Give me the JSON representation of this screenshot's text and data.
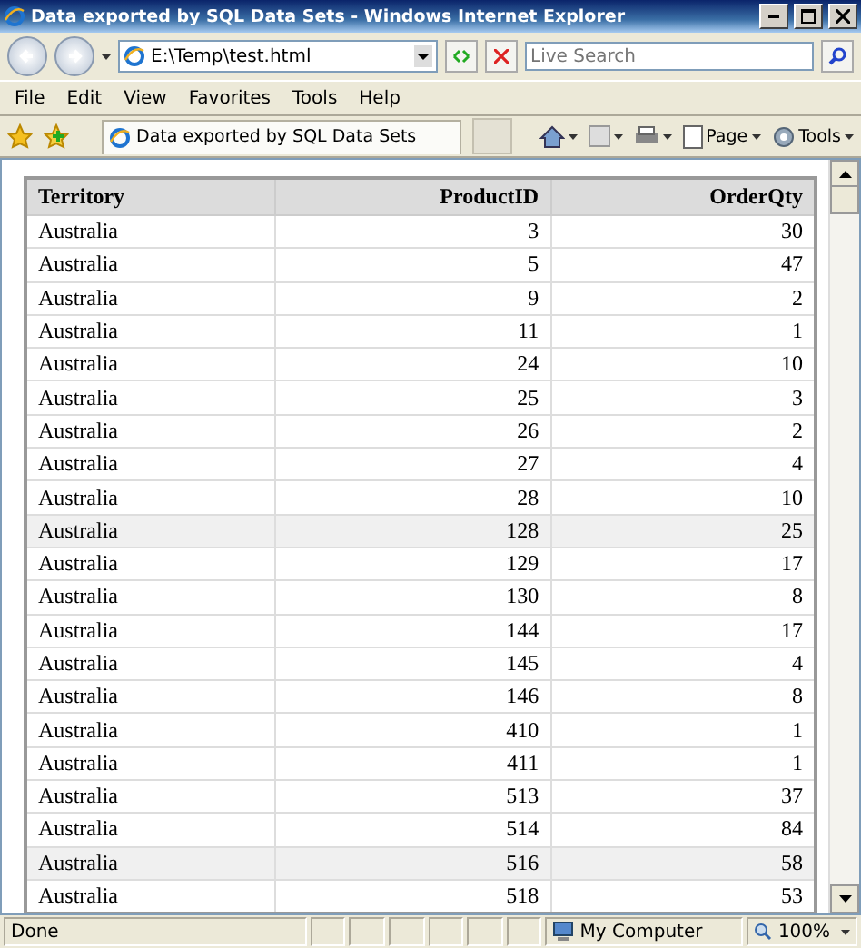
{
  "window": {
    "title": "Data exported by SQL Data Sets - Windows Internet Explorer"
  },
  "address_bar": {
    "value": "E:\\Temp\\test.html"
  },
  "search": {
    "placeholder": "Live Search"
  },
  "menu": [
    "File",
    "Edit",
    "View",
    "Favorites",
    "Tools",
    "Help"
  ],
  "tab": {
    "label": "Data exported by SQL Data Sets",
    "selected": true
  },
  "command_bar": [
    {
      "kind": "icon"
    },
    {
      "kind": "icon"
    },
    {
      "kind": "icon"
    },
    {
      "kind": "text",
      "label": "Page"
    },
    {
      "kind": "text",
      "label": "Tools"
    }
  ],
  "table": {
    "columns": [
      "Territory",
      "ProductID",
      "OrderQty"
    ],
    "rows": [
      {
        "cells": [
          "Australia",
          "3",
          "30"
        ],
        "highlighted": false
      },
      {
        "cells": [
          "Australia",
          "5",
          "47"
        ],
        "highlighted": false
      },
      {
        "cells": [
          "Australia",
          "9",
          "2"
        ],
        "highlighted": false
      },
      {
        "cells": [
          "Australia",
          "11",
          "1"
        ],
        "highlighted": false
      },
      {
        "cells": [
          "Australia",
          "24",
          "10"
        ],
        "highlighted": false
      },
      {
        "cells": [
          "Australia",
          "25",
          "3"
        ],
        "highlighted": false
      },
      {
        "cells": [
          "Australia",
          "26",
          "2"
        ],
        "highlighted": false
      },
      {
        "cells": [
          "Australia",
          "27",
          "4"
        ],
        "highlighted": false
      },
      {
        "cells": [
          "Australia",
          "28",
          "10"
        ],
        "highlighted": false
      },
      {
        "cells": [
          "Australia",
          "128",
          "25"
        ],
        "highlighted": true
      },
      {
        "cells": [
          "Australia",
          "129",
          "17"
        ],
        "highlighted": false
      },
      {
        "cells": [
          "Australia",
          "130",
          "8"
        ],
        "highlighted": false
      },
      {
        "cells": [
          "Australia",
          "144",
          "17"
        ],
        "highlighted": false
      },
      {
        "cells": [
          "Australia",
          "145",
          "4"
        ],
        "highlighted": false
      },
      {
        "cells": [
          "Australia",
          "146",
          "8"
        ],
        "highlighted": false
      },
      {
        "cells": [
          "Australia",
          "410",
          "1"
        ],
        "highlighted": false
      },
      {
        "cells": [
          "Australia",
          "411",
          "1"
        ],
        "highlighted": false
      },
      {
        "cells": [
          "Australia",
          "513",
          "37"
        ],
        "highlighted": false
      },
      {
        "cells": [
          "Australia",
          "514",
          "84"
        ],
        "highlighted": false
      },
      {
        "cells": [
          "Australia",
          "516",
          "58"
        ],
        "highlighted": true
      },
      {
        "cells": [
          "Australia",
          "518",
          "53"
        ],
        "highlighted": false
      }
    ]
  },
  "status_bar": {
    "text": "Done",
    "zone": "My Computer",
    "zoom": "100%"
  }
}
